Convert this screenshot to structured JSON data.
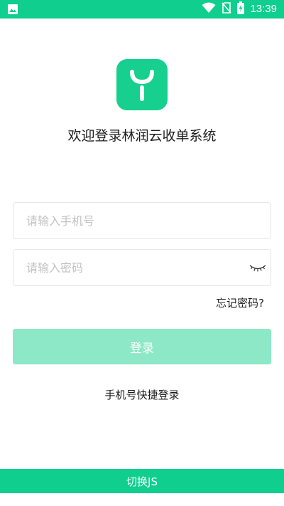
{
  "status_bar": {
    "time": "13:39",
    "background_color": "#0fce8e",
    "icons": [
      "image-notification-icon",
      "wifi-icon",
      "no-sim-icon",
      "battery-charging-icon"
    ]
  },
  "logo": {
    "icon": "app-logo-icon",
    "color": "#17d08f"
  },
  "welcome_title": "欢迎登录林润云收单系统",
  "phone_input": {
    "placeholder": "请输入手机号",
    "value": ""
  },
  "password_input": {
    "placeholder": "请输入密码",
    "value": "",
    "toggle_icon": "eye-closed-icon"
  },
  "forgot_password": "忘记密码?",
  "login_button": {
    "label": "登录",
    "color": "#8ce8c7"
  },
  "quick_login": "手机号快捷登录",
  "switch_button": {
    "label": "切换JS",
    "color": "#0fce8e"
  }
}
